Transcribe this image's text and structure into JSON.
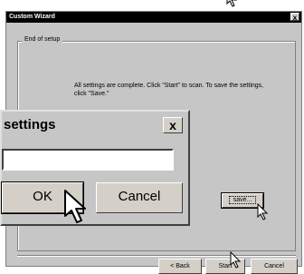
{
  "window": {
    "title": "Custom Wizard",
    "close_glyph": "x",
    "group_label": "End of setup",
    "message": "All settings are complete. Click \"Start\" to scan. To save the settings, click \"Save.\"",
    "save_label": "save...",
    "back_label": "< Back",
    "start_label": "Start",
    "cancel_label": "Cancel"
  },
  "dialog": {
    "title": "settings",
    "close_glyph": "x",
    "input_value": "",
    "ok_label": "OK",
    "cancel_label": "Cancel"
  },
  "icons": [
    "arrow-cursor-icon"
  ]
}
